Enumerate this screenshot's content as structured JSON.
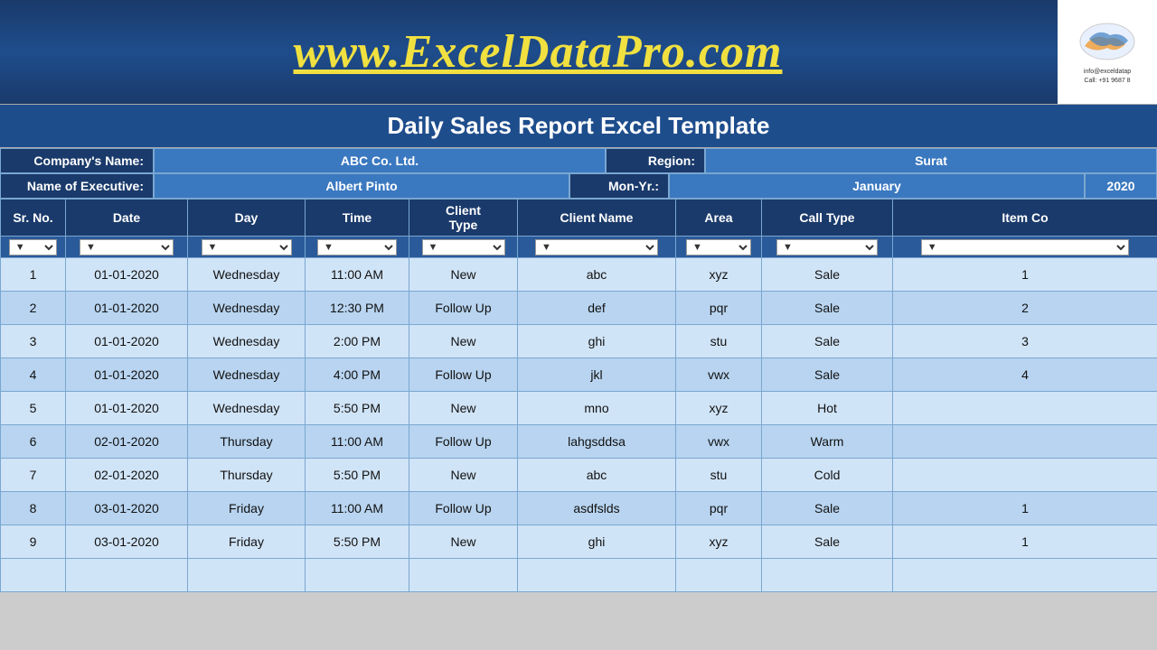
{
  "header": {
    "website": "www.ExcelDataPro.com",
    "logo_info1": "info@exceldatap",
    "logo_info2": "Call: +91 9687 8"
  },
  "report": {
    "title": "Daily Sales Report Excel Template",
    "company_label": "Company's Name:",
    "company_value": "ABC Co. Ltd.",
    "region_label": "Region:",
    "region_value": "Surat",
    "executive_label": "Name of Executive:",
    "executive_value": "Albert Pinto",
    "monyr_label": "Mon-Yr.:",
    "monyr_value": "January",
    "year_value": "2020"
  },
  "table": {
    "headers": [
      "Sr. No.",
      "Date",
      "Day",
      "Time",
      "Client Type",
      "Client Name",
      "Area",
      "Call Type",
      "Item Co"
    ],
    "rows": [
      {
        "srno": "1",
        "date": "01-01-2020",
        "day": "Wednesday",
        "time": "11:00 AM",
        "clienttype": "New",
        "clientname": "abc",
        "area": "xyz",
        "calltype": "Sale",
        "itemcode": "1"
      },
      {
        "srno": "2",
        "date": "01-01-2020",
        "day": "Wednesday",
        "time": "12:30 PM",
        "clienttype": "Follow Up",
        "clientname": "def",
        "area": "pqr",
        "calltype": "Sale",
        "itemcode": "2"
      },
      {
        "srno": "3",
        "date": "01-01-2020",
        "day": "Wednesday",
        "time": "2:00 PM",
        "clienttype": "New",
        "clientname": "ghi",
        "area": "stu",
        "calltype": "Sale",
        "itemcode": "3"
      },
      {
        "srno": "4",
        "date": "01-01-2020",
        "day": "Wednesday",
        "time": "4:00 PM",
        "clienttype": "Follow Up",
        "clientname": "jkl",
        "area": "vwx",
        "calltype": "Sale",
        "itemcode": "4"
      },
      {
        "srno": "5",
        "date": "01-01-2020",
        "day": "Wednesday",
        "time": "5:50 PM",
        "clienttype": "New",
        "clientname": "mno",
        "area": "xyz",
        "calltype": "Hot",
        "itemcode": ""
      },
      {
        "srno": "6",
        "date": "02-01-2020",
        "day": "Thursday",
        "time": "11:00 AM",
        "clienttype": "Follow Up",
        "clientname": "lahgsddsa",
        "area": "vwx",
        "calltype": "Warm",
        "itemcode": ""
      },
      {
        "srno": "7",
        "date": "02-01-2020",
        "day": "Thursday",
        "time": "5:50 PM",
        "clienttype": "New",
        "clientname": "abc",
        "area": "stu",
        "calltype": "Cold",
        "itemcode": ""
      },
      {
        "srno": "8",
        "date": "03-01-2020",
        "day": "Friday",
        "time": "11:00 AM",
        "clienttype": "Follow Up",
        "clientname": "asdfslds",
        "area": "pqr",
        "calltype": "Sale",
        "itemcode": "1"
      },
      {
        "srno": "9",
        "date": "03-01-2020",
        "day": "Friday",
        "time": "5:50 PM",
        "clienttype": "New",
        "clientname": "ghi",
        "area": "xyz",
        "calltype": "Sale",
        "itemcode": "1"
      }
    ]
  }
}
